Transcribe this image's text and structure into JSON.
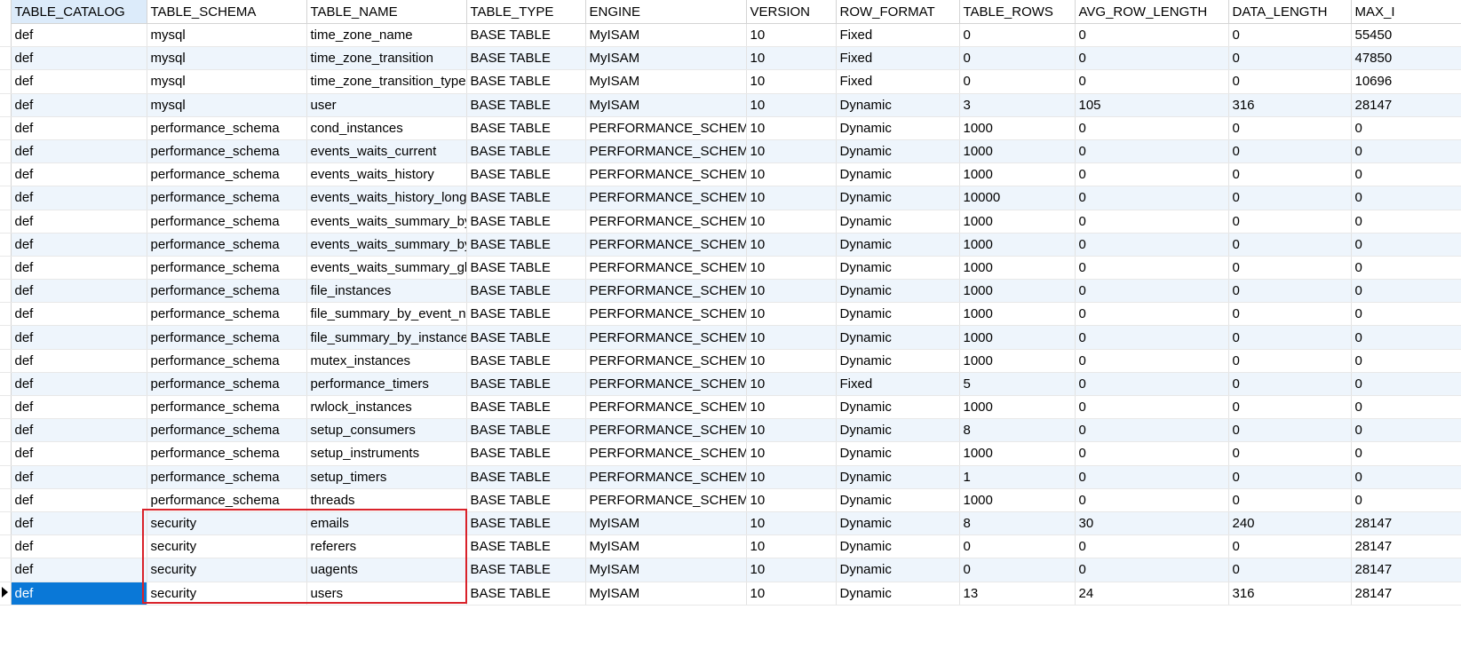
{
  "columns": [
    "TABLE_CATALOG",
    "TABLE_SCHEMA",
    "TABLE_NAME",
    "TABLE_TYPE",
    "ENGINE",
    "VERSION",
    "ROW_FORMAT",
    "TABLE_ROWS",
    "AVG_ROW_LENGTH",
    "DATA_LENGTH",
    "MAX_I"
  ],
  "rows": [
    [
      "def",
      "mysql",
      "time_zone_name",
      "BASE TABLE",
      "MyISAM",
      "10",
      "Fixed",
      "0",
      "0",
      "0",
      "55450"
    ],
    [
      "def",
      "mysql",
      "time_zone_transition",
      "BASE TABLE",
      "MyISAM",
      "10",
      "Fixed",
      "0",
      "0",
      "0",
      "47850"
    ],
    [
      "def",
      "mysql",
      "time_zone_transition_type",
      "BASE TABLE",
      "MyISAM",
      "10",
      "Fixed",
      "0",
      "0",
      "0",
      "10696"
    ],
    [
      "def",
      "mysql",
      "user",
      "BASE TABLE",
      "MyISAM",
      "10",
      "Dynamic",
      "3",
      "105",
      "316",
      "28147"
    ],
    [
      "def",
      "performance_schema",
      "cond_instances",
      "BASE TABLE",
      "PERFORMANCE_SCHEMA",
      "10",
      "Dynamic",
      "1000",
      "0",
      "0",
      "0"
    ],
    [
      "def",
      "performance_schema",
      "events_waits_current",
      "BASE TABLE",
      "PERFORMANCE_SCHEMA",
      "10",
      "Dynamic",
      "1000",
      "0",
      "0",
      "0"
    ],
    [
      "def",
      "performance_schema",
      "events_waits_history",
      "BASE TABLE",
      "PERFORMANCE_SCHEMA",
      "10",
      "Dynamic",
      "1000",
      "0",
      "0",
      "0"
    ],
    [
      "def",
      "performance_schema",
      "events_waits_history_long",
      "BASE TABLE",
      "PERFORMANCE_SCHEMA",
      "10",
      "Dynamic",
      "10000",
      "0",
      "0",
      "0"
    ],
    [
      "def",
      "performance_schema",
      "events_waits_summary_by",
      "BASE TABLE",
      "PERFORMANCE_SCHEMA",
      "10",
      "Dynamic",
      "1000",
      "0",
      "0",
      "0"
    ],
    [
      "def",
      "performance_schema",
      "events_waits_summary_by",
      "BASE TABLE",
      "PERFORMANCE_SCHEMA",
      "10",
      "Dynamic",
      "1000",
      "0",
      "0",
      "0"
    ],
    [
      "def",
      "performance_schema",
      "events_waits_summary_gl",
      "BASE TABLE",
      "PERFORMANCE_SCHEMA",
      "10",
      "Dynamic",
      "1000",
      "0",
      "0",
      "0"
    ],
    [
      "def",
      "performance_schema",
      "file_instances",
      "BASE TABLE",
      "PERFORMANCE_SCHEMA",
      "10",
      "Dynamic",
      "1000",
      "0",
      "0",
      "0"
    ],
    [
      "def",
      "performance_schema",
      "file_summary_by_event_na",
      "BASE TABLE",
      "PERFORMANCE_SCHEMA",
      "10",
      "Dynamic",
      "1000",
      "0",
      "0",
      "0"
    ],
    [
      "def",
      "performance_schema",
      "file_summary_by_instance",
      "BASE TABLE",
      "PERFORMANCE_SCHEMA",
      "10",
      "Dynamic",
      "1000",
      "0",
      "0",
      "0"
    ],
    [
      "def",
      "performance_schema",
      "mutex_instances",
      "BASE TABLE",
      "PERFORMANCE_SCHEMA",
      "10",
      "Dynamic",
      "1000",
      "0",
      "0",
      "0"
    ],
    [
      "def",
      "performance_schema",
      "performance_timers",
      "BASE TABLE",
      "PERFORMANCE_SCHEMA",
      "10",
      "Fixed",
      "5",
      "0",
      "0",
      "0"
    ],
    [
      "def",
      "performance_schema",
      "rwlock_instances",
      "BASE TABLE",
      "PERFORMANCE_SCHEMA",
      "10",
      "Dynamic",
      "1000",
      "0",
      "0",
      "0"
    ],
    [
      "def",
      "performance_schema",
      "setup_consumers",
      "BASE TABLE",
      "PERFORMANCE_SCHEMA",
      "10",
      "Dynamic",
      "8",
      "0",
      "0",
      "0"
    ],
    [
      "def",
      "performance_schema",
      "setup_instruments",
      "BASE TABLE",
      "PERFORMANCE_SCHEMA",
      "10",
      "Dynamic",
      "1000",
      "0",
      "0",
      "0"
    ],
    [
      "def",
      "performance_schema",
      "setup_timers",
      "BASE TABLE",
      "PERFORMANCE_SCHEMA",
      "10",
      "Dynamic",
      "1",
      "0",
      "0",
      "0"
    ],
    [
      "def",
      "performance_schema",
      "threads",
      "BASE TABLE",
      "PERFORMANCE_SCHEMA",
      "10",
      "Dynamic",
      "1000",
      "0",
      "0",
      "0"
    ],
    [
      "def",
      "security",
      "emails",
      "BASE TABLE",
      "MyISAM",
      "10",
      "Dynamic",
      "8",
      "30",
      "240",
      "28147"
    ],
    [
      "def",
      "security",
      "referers",
      "BASE TABLE",
      "MyISAM",
      "10",
      "Dynamic",
      "0",
      "0",
      "0",
      "28147"
    ],
    [
      "def",
      "security",
      "uagents",
      "BASE TABLE",
      "MyISAM",
      "10",
      "Dynamic",
      "0",
      "0",
      "0",
      "28147"
    ],
    [
      "def",
      "security",
      "users",
      "BASE TABLE",
      "MyISAM",
      "10",
      "Dynamic",
      "13",
      "24",
      "316",
      "28147"
    ]
  ],
  "current_row_index": 24,
  "colors": {
    "selected_cell": "#0a78d7",
    "active_header": "#dcebfa",
    "alt_row": "#eef5fc",
    "highlight_box": "#d9222a"
  }
}
